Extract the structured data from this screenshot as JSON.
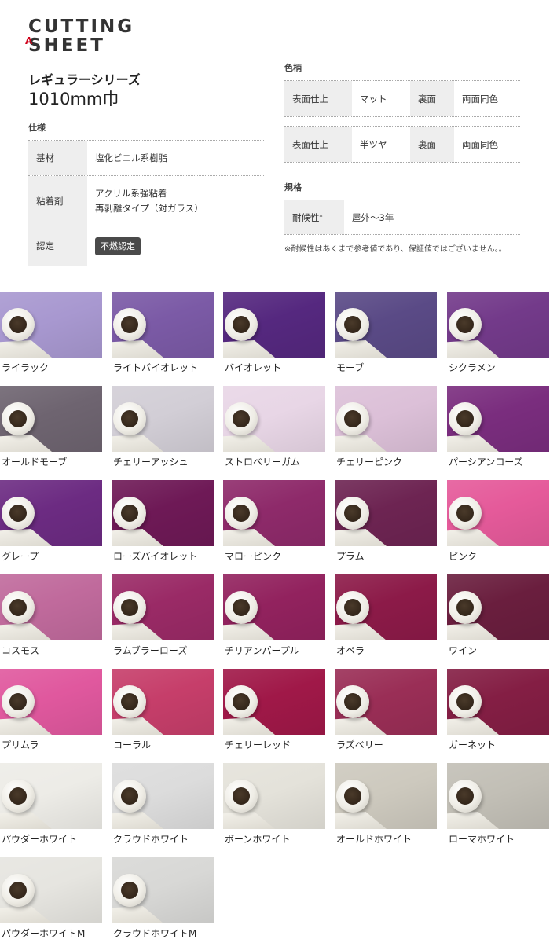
{
  "brand": {
    "line1": "CUTTING",
    "line2": "SHEET",
    "mark": "A"
  },
  "series": "レギュラーシリーズ",
  "width": "1010mm巾",
  "spec": {
    "title": "仕様",
    "rows": [
      {
        "key": "基材",
        "values": [
          "塩化ビニル系樹脂"
        ]
      },
      {
        "key": "粘着剤",
        "values": [
          "アクリル系強粘着",
          "再剥離タイプ（対ガラス）"
        ]
      },
      {
        "key": "認定",
        "badge": "不燃認定"
      }
    ]
  },
  "pattern": {
    "title": "色柄",
    "rows": [
      {
        "k1": "表面仕上",
        "v1": "マット",
        "k2": "裏面",
        "v2": "両面同色"
      },
      {
        "k1": "表面仕上",
        "v1": "半ツヤ",
        "k2": "裏面",
        "v2": "両面同色"
      }
    ]
  },
  "standard": {
    "title": "規格",
    "key": "耐候性",
    "key_mark": "*",
    "value": "屋外～3年",
    "note": "※耐候性はあくまで参考値であり、保証値ではございません。。"
  },
  "swatches": [
    {
      "name": "ライラック",
      "color": "#a898d0"
    },
    {
      "name": "ライトバイオレット",
      "color": "#7b5aa6"
    },
    {
      "name": "バイオレット",
      "color": "#55287f"
    },
    {
      "name": "モーブ",
      "color": "#5a4a86"
    },
    {
      "name": "シクラメン",
      "color": "#733a8a"
    },
    {
      "name": "オールドモーブ",
      "color": "#6e6470"
    },
    {
      "name": "チェリーアッシュ",
      "color": "#d2ced6"
    },
    {
      "name": "ストロベリーガム",
      "color": "#e8d6e6"
    },
    {
      "name": "チェリーピンク",
      "color": "#dcc0d8"
    },
    {
      "name": "パーシアンローズ",
      "color": "#7a2d7e"
    },
    {
      "name": "グレープ",
      "color": "#6c2b82"
    },
    {
      "name": "ローズバイオレット",
      "color": "#6e1956"
    },
    {
      "name": "マローピンク",
      "color": "#8e2a6a"
    },
    {
      "name": "プラム",
      "color": "#6d2452"
    },
    {
      "name": "ピンク",
      "color": "#e55a9a"
    },
    {
      "name": "コスモス",
      "color": "#c06a9c"
    },
    {
      "name": "ラムブラーローズ",
      "color": "#9a2a66"
    },
    {
      "name": "チリアンパープル",
      "color": "#92225e"
    },
    {
      "name": "オペラ",
      "color": "#8c1a48"
    },
    {
      "name": "ワイン",
      "color": "#6a1e3e"
    },
    {
      "name": "プリムラ",
      "color": "#e0589e"
    },
    {
      "name": "コーラル",
      "color": "#c63e6a"
    },
    {
      "name": "チェリーレッド",
      "color": "#a01848"
    },
    {
      "name": "ラズベリー",
      "color": "#9a2e56"
    },
    {
      "name": "ガーネット",
      "color": "#841e44"
    },
    {
      "name": "パウダーホワイト",
      "color": "#edece7"
    },
    {
      "name": "クラウドホワイト",
      "color": "#dcdcdc"
    },
    {
      "name": "ボーンホワイト",
      "color": "#e4e2da"
    },
    {
      "name": "オールドホワイト",
      "color": "#cdc9be"
    },
    {
      "name": "ローマホワイト",
      "color": "#c2bfb6"
    },
    {
      "name": "パウダーホワイトM",
      "color": "#e6e5e0"
    },
    {
      "name": "クラウドホワイトM",
      "color": "#d8d8d6"
    }
  ]
}
